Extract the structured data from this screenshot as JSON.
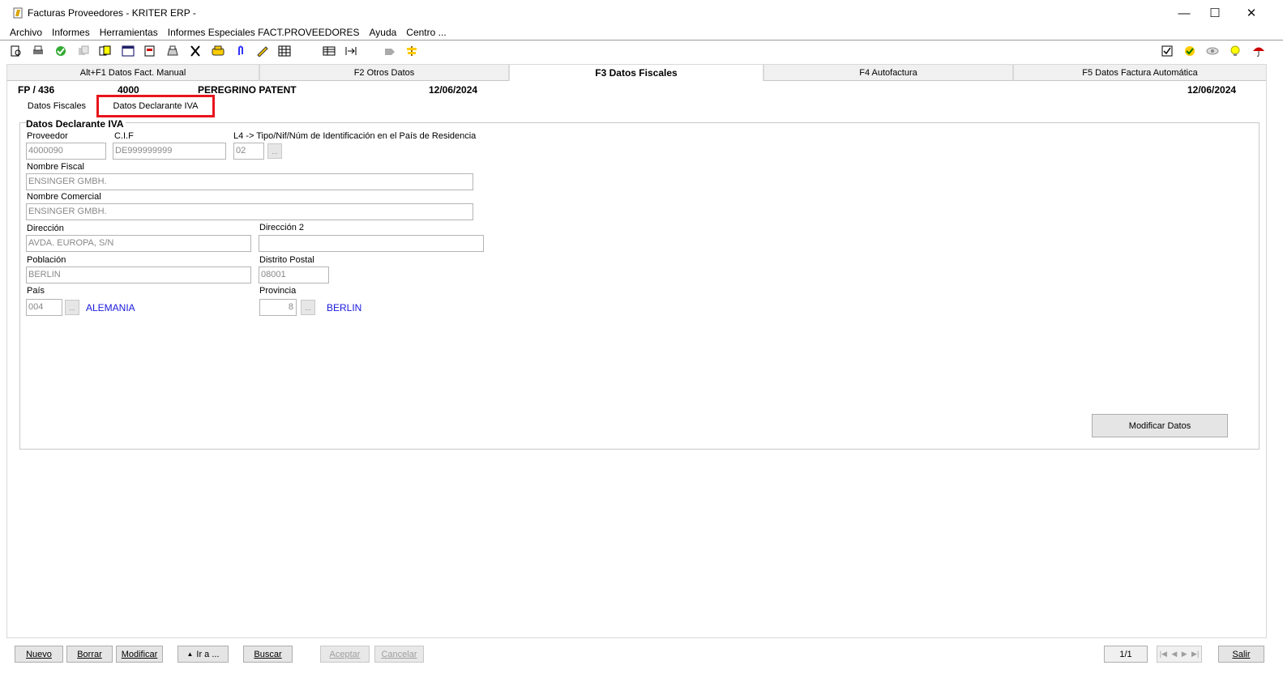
{
  "window": {
    "title": "Facturas Proveedores  - KRITER ERP -",
    "controls": {
      "minimize": "—",
      "maximize": "☐",
      "close": "✕"
    }
  },
  "menu": [
    "Archivo",
    "Informes",
    "Herramientas",
    "Informes Especiales FACT.PROVEEDORES",
    "Ayuda",
    "Centro ..."
  ],
  "toolbar": {
    "icons": [
      "preview-icon",
      "print-icon",
      "check-icon",
      "copy-icon",
      "documents-icon",
      "calendar-icon",
      "report-icon",
      "printer-icon",
      "scissors-icon",
      "phone-icon",
      "attachment-icon",
      "pencil-icon",
      "grid-icon",
      "table-icon",
      "fit-icon",
      "tag-icon",
      "signpost-icon",
      "checkbox-icon",
      "approve-icon",
      "eye-icon",
      "lightbulb-icon",
      "umbrella-icon"
    ]
  },
  "main_tabs": [
    {
      "label": "Alt+F1 Datos Fact. Manual",
      "active": false
    },
    {
      "label": "F2 Otros Datos",
      "active": false
    },
    {
      "label": "F3 Datos Fiscales",
      "active": true
    },
    {
      "label": "F4 Autofactura",
      "active": false
    },
    {
      "label": "F5 Datos Factura Automática",
      "active": false
    }
  ],
  "header": {
    "doc": "FP / 436",
    "code": "4000",
    "name": "PEREGRINO PATENT",
    "date1": "12/06/2024",
    "date2": "12/06/2024"
  },
  "sub_tabs": [
    {
      "label": "Datos Fiscales",
      "active": false
    },
    {
      "label": "Datos Declarante IVA",
      "active": true
    }
  ],
  "form": {
    "group_title": "Datos Declarante IVA",
    "proveedor": {
      "label": "Proveedor",
      "value": "4000090"
    },
    "cif": {
      "label": "C.I.F",
      "value": "DE999999999"
    },
    "l4": {
      "label": "L4 -> Tipo/Nif/Núm de Identificación en el País de Residencia",
      "value": "02"
    },
    "nombre_fiscal": {
      "label": "Nombre Fiscal",
      "value": "ENSINGER GMBH."
    },
    "nombre_comercial": {
      "label": "Nombre Comercial",
      "value": "ENSINGER GMBH."
    },
    "direccion": {
      "label": "Dirección",
      "value": "AVDA. EUROPA, S/N"
    },
    "direccion2": {
      "label": "Dirección 2",
      "value": ""
    },
    "poblacion": {
      "label": "Población",
      "value": "BERLIN"
    },
    "distrito_postal": {
      "label": "Distrito Postal",
      "value": "08001"
    },
    "pais": {
      "label": "País",
      "value": "004",
      "name": "ALEMANIA"
    },
    "provincia": {
      "label": "Provincia",
      "value": "8",
      "name": "BERLIN"
    },
    "ellipsis": "...",
    "modify_button": "Modificar Datos"
  },
  "bottom": {
    "nuevo": "Nuevo",
    "borrar": "Borrar",
    "modificar": "Modificar",
    "ir_a": "Ir a ...",
    "buscar": "Buscar",
    "aceptar": "Aceptar",
    "cancelar": "Cancelar",
    "pager": "1/1",
    "salir": "Salir"
  },
  "colors": {
    "highlight": "#e8141c",
    "link_blue": "#1a1adc"
  }
}
